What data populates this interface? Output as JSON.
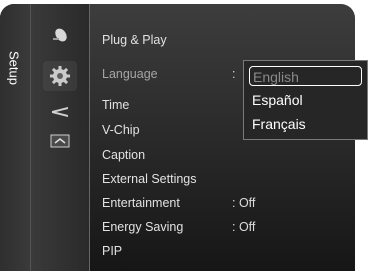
{
  "side_tab": {
    "label": "Setup"
  },
  "categories": [
    {
      "icon": "satellite-icon"
    },
    {
      "icon": "gear-icon",
      "active": true
    },
    {
      "icon": "antenna-icon"
    },
    {
      "icon": "input-source-icon"
    }
  ],
  "menu": {
    "items": [
      {
        "label": "Plug & Play",
        "value": ""
      },
      {
        "label": "Language",
        "value": ":"
      },
      {
        "label": "Time",
        "value": ""
      },
      {
        "label": "V-Chip",
        "value": ""
      },
      {
        "label": "Caption",
        "value": ""
      },
      {
        "label": "External Settings",
        "value": ""
      },
      {
        "label": "Entertainment",
        "value": ": Off"
      },
      {
        "label": "Energy Saving",
        "value": ": Off"
      },
      {
        "label": "PIP",
        "value": ""
      }
    ]
  },
  "language_dropdown": {
    "options": [
      "English",
      "Español",
      "Français"
    ],
    "selected": "English"
  },
  "colors": {
    "panel": "#262626",
    "text": "#e2e2e2",
    "highlight_border": "#ffffff"
  }
}
